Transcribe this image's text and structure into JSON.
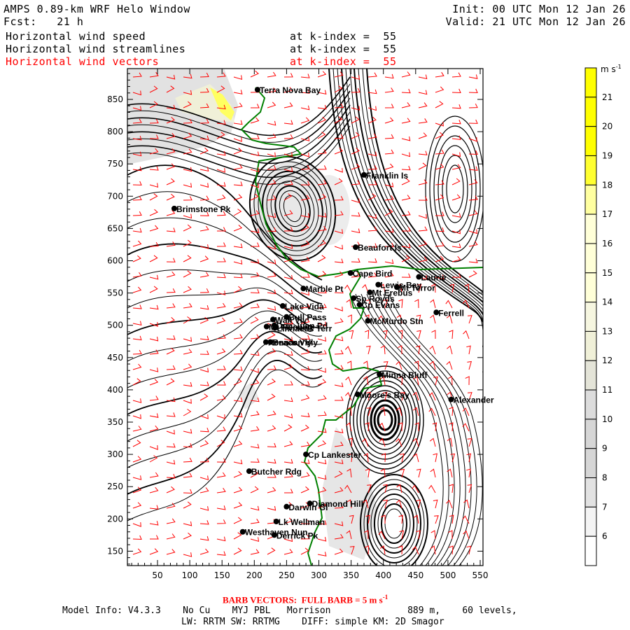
{
  "header": {
    "title": "AMPS 0.89-km WRF Helo Window",
    "fcst": "Fcst:   21 h",
    "init": "Init: 00 UTC Mon 12 Jan 26",
    "valid": "Valid: 21 UTC Mon 12 Jan 26",
    "fields": [
      {
        "name": "Horizontal wind speed",
        "level": "at k-index =  55",
        "color": "#000000"
      },
      {
        "name": "Horizontal wind streamlines",
        "level": "at k-index =  55",
        "color": "#000000"
      },
      {
        "name": "Horizontal wind vectors",
        "level": "at k-index =  55",
        "color": "#ff0000"
      }
    ]
  },
  "chart_data": {
    "type": "heatmap",
    "title": "Horizontal wind speed, streamlines and vectors at k-index 55",
    "xlim": [
      3,
      555
    ],
    "ylim": [
      126,
      898
    ],
    "x_ticks": [
      50,
      100,
      150,
      200,
      250,
      300,
      350,
      400,
      450,
      500,
      550
    ],
    "y_ticks": [
      150,
      200,
      250,
      300,
      350,
      400,
      450,
      500,
      550,
      600,
      650,
      700,
      750,
      800,
      850
    ],
    "colorbar": {
      "units": "m s",
      "units_exp": "-1",
      "levels": [
        6,
        7,
        8,
        9,
        10,
        11,
        12,
        13,
        14,
        15,
        16,
        17,
        18,
        19,
        20,
        21
      ],
      "colors": [
        "#ffffff",
        "#f4f4f4",
        "#e2e2e2",
        "#d6d6d6",
        "#d6d6d6",
        "#dcdcdc",
        "#e4e4d8",
        "#f0f0d8",
        "#f6f6e0",
        "#ffffd8",
        "#ffffd8",
        "#ffffd8",
        "#ffffa0",
        "#ffff30",
        "#ffff00",
        "#ffff00",
        "#ffff00"
      ]
    },
    "stations": [
      {
        "name": "Terra Nova Bay",
        "x": 205,
        "y": 865
      },
      {
        "name": "Franklin Is",
        "x": 370,
        "y": 733
      },
      {
        "name": "Brimstone Pk",
        "x": 76,
        "y": 681
      },
      {
        "name": "Beaufort Is",
        "x": 357,
        "y": 621
      },
      {
        "name": "Cape Bird",
        "x": 349,
        "y": 581
      },
      {
        "name": "Marble Pt",
        "x": 276,
        "y": 557
      },
      {
        "name": "Lewis Bay",
        "x": 392,
        "y": 563
      },
      {
        "name": "Mt Terror",
        "x": 421,
        "y": 559
      },
      {
        "name": "Laurie",
        "x": 455,
        "y": 575
      },
      {
        "name": "Sp Royds",
        "x": 354,
        "y": 542
      },
      {
        "name": "Mt Erebus",
        "x": 379,
        "y": 551
      },
      {
        "name": "Cp Evans",
        "x": 363,
        "y": 532
      },
      {
        "name": "McMurdo Stn",
        "x": 376,
        "y": 507
      },
      {
        "name": "Ferrell",
        "x": 482,
        "y": 520
      },
      {
        "name": "Lake Vida",
        "x": 244,
        "y": 530
      },
      {
        "name": "Wall Vly",
        "x": 229,
        "y": 509
      },
      {
        "name": "Bull Pass",
        "x": 250,
        "y": 513
      },
      {
        "name": "Don Juan Pd",
        "x": 231,
        "y": 500
      },
      {
        "name": "Mt Fleming",
        "x": 219,
        "y": 498
      },
      {
        "name": "Linnaeus Terr",
        "x": 232,
        "y": 496
      },
      {
        "name": "Kennar Vly",
        "x": 218,
        "y": 474
      },
      {
        "name": "Beacon Vly",
        "x": 225,
        "y": 474
      },
      {
        "name": "Minna Bluff",
        "x": 394,
        "y": 424
      },
      {
        "name": "Moore's Bay",
        "x": 360,
        "y": 393
      },
      {
        "name": "Alexander",
        "x": 505,
        "y": 385
      },
      {
        "name": "Cp Lankester",
        "x": 280,
        "y": 300
      },
      {
        "name": "Butcher Rdg",
        "x": 192,
        "y": 274
      },
      {
        "name": "Diamond Hill",
        "x": 286,
        "y": 224
      },
      {
        "name": "Darwin Gl",
        "x": 250,
        "y": 219
      },
      {
        "name": "Lk Wellman",
        "x": 234,
        "y": 196
      },
      {
        "name": "Westhaven Nun",
        "x": 182,
        "y": 180
      },
      {
        "name": "Derrick Pk",
        "x": 231,
        "y": 175
      }
    ],
    "barb_color": "#ff0000",
    "coast_color": "#008000"
  },
  "footer": {
    "barb_note": "BARB VECTORS:  FULL BARB = 5 m s",
    "barb_exp": "-1",
    "model_line1": "Model Info: V4.3.3    No Cu    MYJ PBL   Morrison              889 m,    60 levels,",
    "model_line2": "LW: RRTM SW: RRTMG    DIFF: simple KM: 2D Smagor"
  }
}
